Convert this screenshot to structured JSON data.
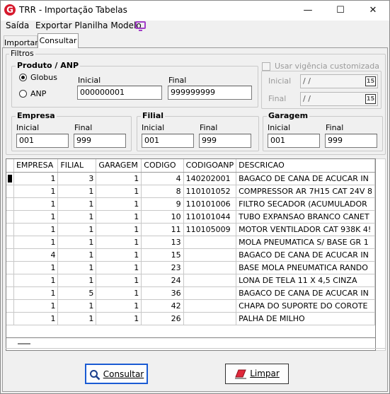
{
  "window": {
    "title": "TRR - Importação Tabelas",
    "minimize": "—",
    "maximize": "☐",
    "close": "✕"
  },
  "menu": {
    "saida": "Saída",
    "exportar": "Exportar Planilha Modelo"
  },
  "tabs": [
    {
      "label": "Importar"
    },
    {
      "label": "Consultar"
    }
  ],
  "filters": {
    "title": "Filtros",
    "produto": {
      "title": "Produto / ANP",
      "options": [
        {
          "label": "Globus",
          "checked": true
        },
        {
          "label": "ANP",
          "checked": false
        }
      ],
      "inicial_label": "Inicial",
      "inicial_value": "000000001",
      "final_label": "Final",
      "final_value": "999999999"
    },
    "vigencia": {
      "checkbox_label": "Usar vigência customizada",
      "checked": false,
      "inicial_label": "Inicial",
      "inicial_value": " / /",
      "final_label": "Final",
      "final_value": " / /",
      "cal_icon": "15"
    },
    "empresa": {
      "title": "Empresa",
      "inicial_label": "Inicial",
      "inicial_value": "001",
      "final_label": "Final",
      "final_value": "999"
    },
    "filial": {
      "title": "Filial",
      "inicial_label": "Inicial",
      "inicial_value": "001",
      "final_label": "Final",
      "final_value": "999"
    },
    "garagem": {
      "title": "Garagem",
      "inicial_label": "Inicial",
      "inicial_value": "001",
      "final_label": "Final",
      "final_value": "999"
    }
  },
  "grid": {
    "columns": [
      "EMPRESA",
      "FILIAL",
      "GARAGEM",
      "CODIGO",
      "CODIGOANP",
      "DESCRICAO"
    ],
    "rows": [
      [
        "1",
        "3",
        "1",
        "4",
        "140202001",
        "BAGACO DE CANA DE ACUCAR IN"
      ],
      [
        "1",
        "1",
        "1",
        "8",
        "110101052",
        "COMPRESSOR AR 7H15 CAT 24V 8"
      ],
      [
        "1",
        "1",
        "1",
        "9",
        "110101006",
        "FILTRO SECADOR (ACUMULADOR"
      ],
      [
        "1",
        "1",
        "1",
        "10",
        "110101044",
        "TUBO EXPANSAO BRANCO CANET"
      ],
      [
        "1",
        "1",
        "1",
        "11",
        "110105009",
        "MOTOR VENTILADOR CAT 938K 4!"
      ],
      [
        "1",
        "1",
        "1",
        "13",
        "",
        "MOLA PNEUMATICA S/ BASE GR 1"
      ],
      [
        "4",
        "1",
        "1",
        "15",
        "",
        "BAGACO DE CANA DE ACUCAR IN"
      ],
      [
        "1",
        "1",
        "1",
        "23",
        "",
        "BASE MOLA PNEUMATICA RANDO"
      ],
      [
        "1",
        "1",
        "1",
        "24",
        "",
        "LONA DE TELA 11 X 4,5 CINZA"
      ],
      [
        "1",
        "5",
        "1",
        "36",
        "",
        "BAGACO DE CANA DE ACUCAR IN"
      ],
      [
        "1",
        "1",
        "1",
        "42",
        "",
        "CHAPA DO SUPORTE DO COROTE"
      ],
      [
        "1",
        "1",
        "1",
        "26",
        "",
        "PALHA DE MILHO"
      ]
    ]
  },
  "buttons": {
    "consultar": "Consultar",
    "limpar": "Limpar"
  }
}
